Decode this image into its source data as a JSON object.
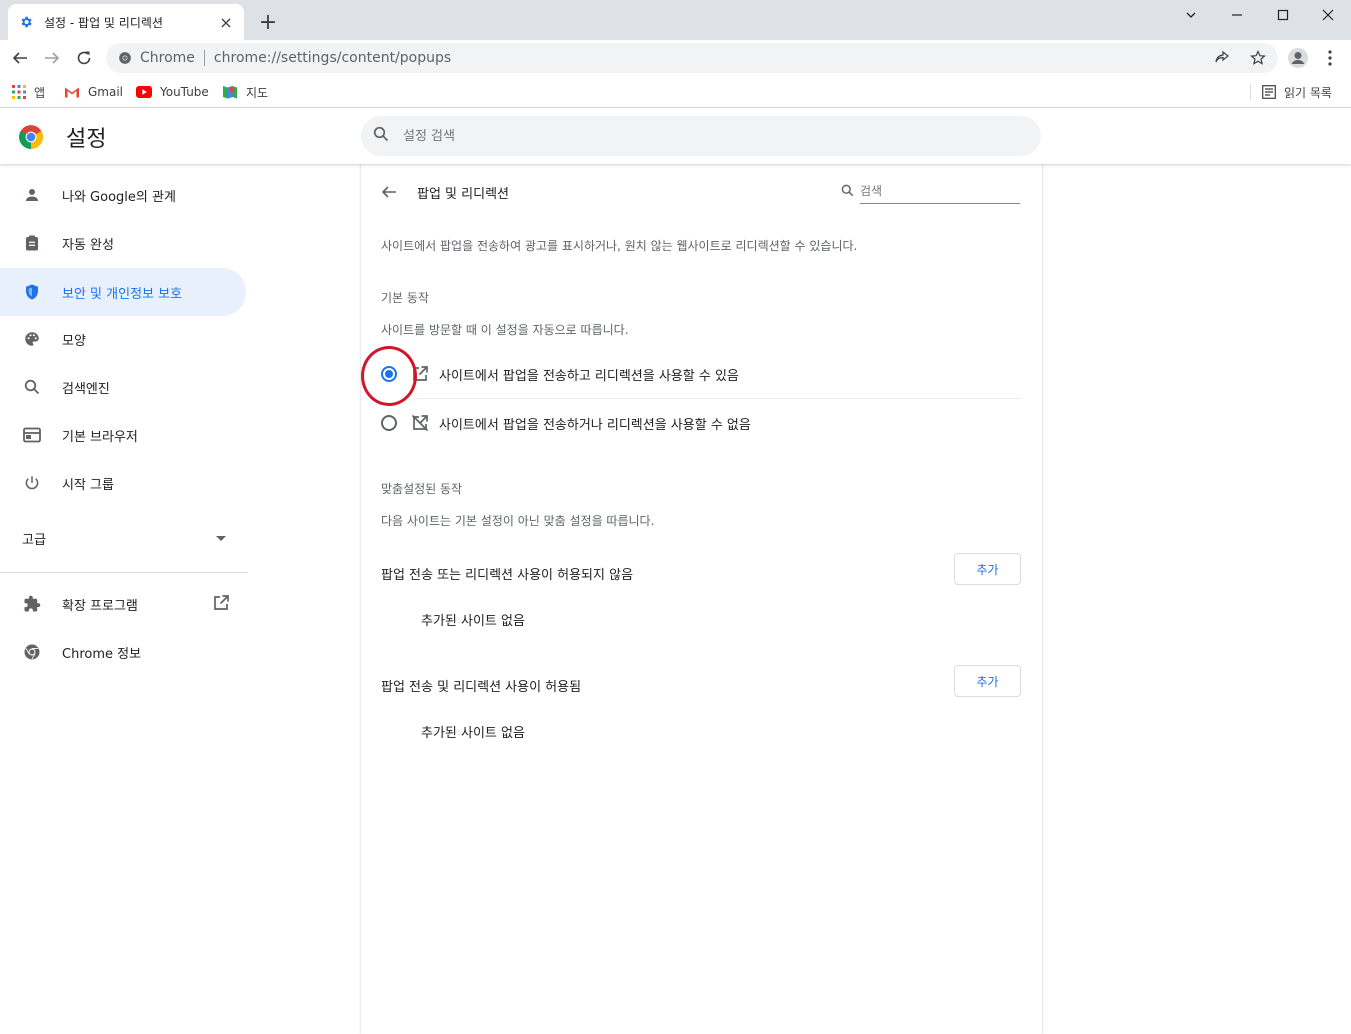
{
  "tab": {
    "title": "설정 - 팝업 및 리디렉션",
    "close": "×"
  },
  "new_tab": "+",
  "toolbar": {
    "omnibox_chip": "Chrome",
    "url": "chrome://settings/content/popups"
  },
  "bookmarks": {
    "items": [
      {
        "label": "앱"
      },
      {
        "label": "Gmail"
      },
      {
        "label": "YouTube"
      },
      {
        "label": "지도"
      }
    ],
    "reading_list": "읽기 목록"
  },
  "header": {
    "title": "설정",
    "search_placeholder": "설정 검색"
  },
  "sidebar": {
    "items": [
      {
        "label": "나와 Google의 관계"
      },
      {
        "label": "자동 완성"
      },
      {
        "label": "보안 및 개인정보 보호"
      },
      {
        "label": "모양"
      },
      {
        "label": "검색엔진"
      },
      {
        "label": "기본 브라우저"
      },
      {
        "label": "시작 그룹"
      }
    ],
    "advanced": "고급",
    "extensions": "확장 프로그램",
    "about": "Chrome 정보"
  },
  "page": {
    "title": "팝업 및 리디렉션",
    "search_placeholder": "검색",
    "description": "사이트에서 팝업을 전송하여 광고를 표시하거나, 원치 않는 웹사이트로 리디렉션할 수 있습니다.",
    "default_behavior": {
      "heading": "기본 동작",
      "subtitle": "사이트를 방문할 때 이 설정을 자동으로 따릅니다.",
      "options": [
        {
          "label": "사이트에서 팝업을 전송하고 리디렉션을 사용할 수 있음",
          "checked": true
        },
        {
          "label": "사이트에서 팝업을 전송하거나 리디렉션을 사용할 수 없음",
          "checked": false
        }
      ]
    },
    "custom_behavior": {
      "heading": "맞춤설정된 동작",
      "subtitle": "다음 사이트는 기본 설정이 아닌 맞춤 설정을 따릅니다.",
      "blocked": {
        "label": "팝업 전송 또는 리디렉션 사용이 허용되지 않음",
        "button": "추가",
        "empty": "추가된 사이트 없음"
      },
      "allowed": {
        "label": "팝업 전송 및 리디렉션 사용이 허용됨",
        "button": "추가",
        "empty": "추가된 사이트 없음"
      }
    }
  },
  "colors": {
    "accent": "#1a73e8",
    "highlight_ring": "#d3152b",
    "active_nav_bg": "#e8f0fe"
  }
}
